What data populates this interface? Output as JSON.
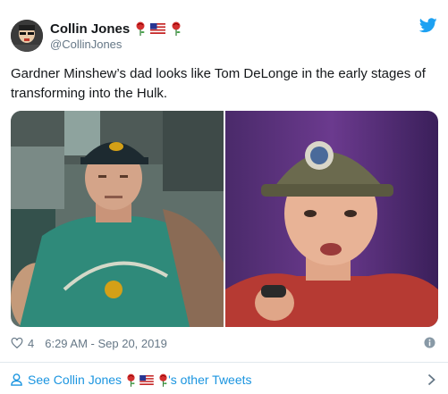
{
  "author": {
    "display_name": "Collin Jones",
    "handle": "@CollinJones",
    "avatar_icon": "avatar-image",
    "name_emojis": [
      "rose-emoji",
      "us-flag-emoji",
      "rose-emoji"
    ]
  },
  "tweet": {
    "text": "Gardner Minshew’s dad looks like Tom DeLonge in the early stages of transforming into the Hulk.",
    "images": [
      {
        "icon": "photo-man-in-jaguars-cap"
      },
      {
        "icon": "photo-man-speaking-into-microphone"
      }
    ]
  },
  "meta": {
    "like_count": "4",
    "timestamp": "6:29 AM - Sep 20, 2019",
    "like_icon": "heart-icon",
    "info_icon": "info-icon"
  },
  "footer": {
    "prefix": "See Collin Jones",
    "suffix": "'s other Tweets",
    "person_icon": "person-icon",
    "chevron_icon": "chevron-right-icon"
  },
  "colors": {
    "link": "#1b95e0",
    "secondary_text": "#657786",
    "divider": "#e1e8ed",
    "twitter_blue": "#1da1f2"
  }
}
